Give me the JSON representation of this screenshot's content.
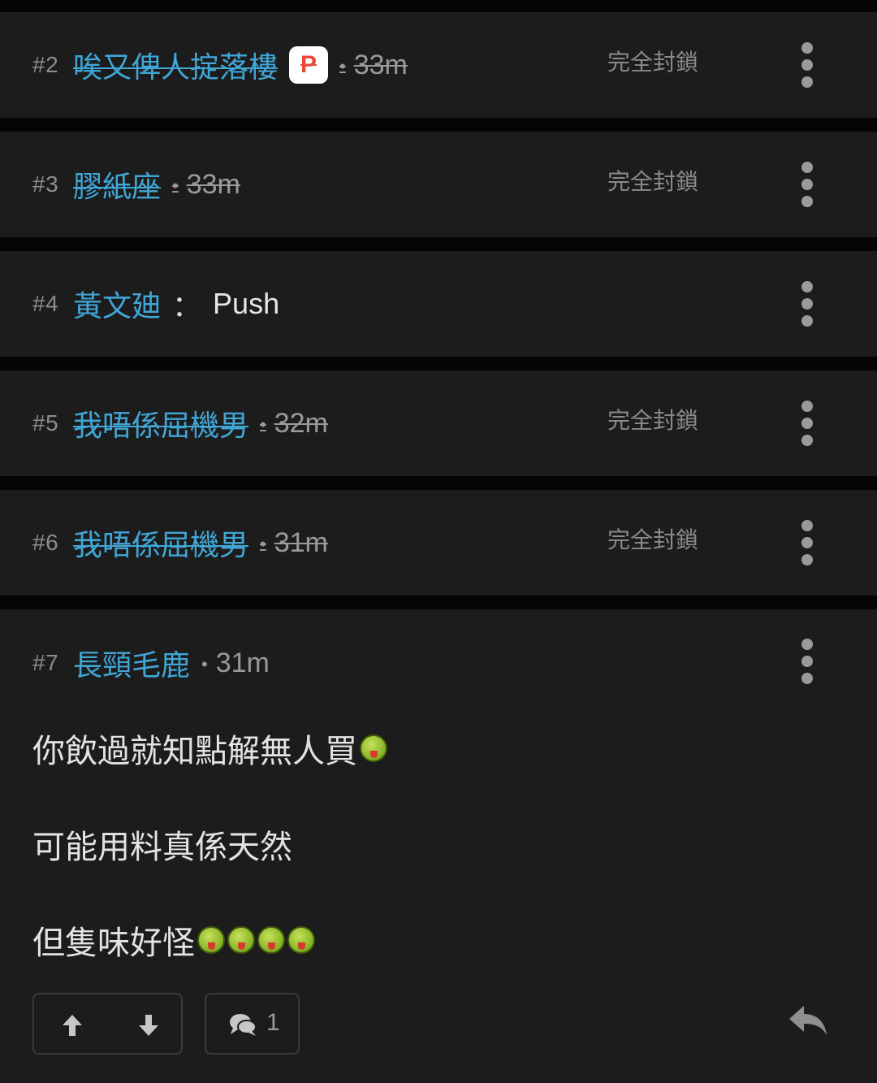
{
  "blocked_label": "完全封鎖",
  "rows": [
    {
      "floor": "#2",
      "name": "唉又俾人掟落樓",
      "badge": "P",
      "time": "33m"
    },
    {
      "floor": "#3",
      "name": "膠紙座",
      "time": "33m"
    },
    {
      "floor": "#4",
      "name": "黃文廸",
      "separator": "：",
      "text": "Push"
    },
    {
      "floor": "#5",
      "name": "我唔係屈機男",
      "time": "32m"
    },
    {
      "floor": "#6",
      "name": "我唔係屈機男",
      "time": "31m"
    }
  ],
  "post": {
    "floor": "#7",
    "name": "長頸毛鹿",
    "time": "31m",
    "lines": [
      "你飲過就知點解無人買",
      "可能用料真係天然",
      "但隻味好怪"
    ],
    "reply_count": "1",
    "icons": {
      "upvote": "arrow-up-icon",
      "downvote": "arrow-down-icon",
      "comment": "chat-bubbles-icon",
      "reply": "reply-arrow-icon",
      "emoji": "sick-face-emoji"
    }
  },
  "colors": {
    "accent": "#40a6d6",
    "background": "#1c1c1c",
    "badge": "#e84a3a"
  }
}
